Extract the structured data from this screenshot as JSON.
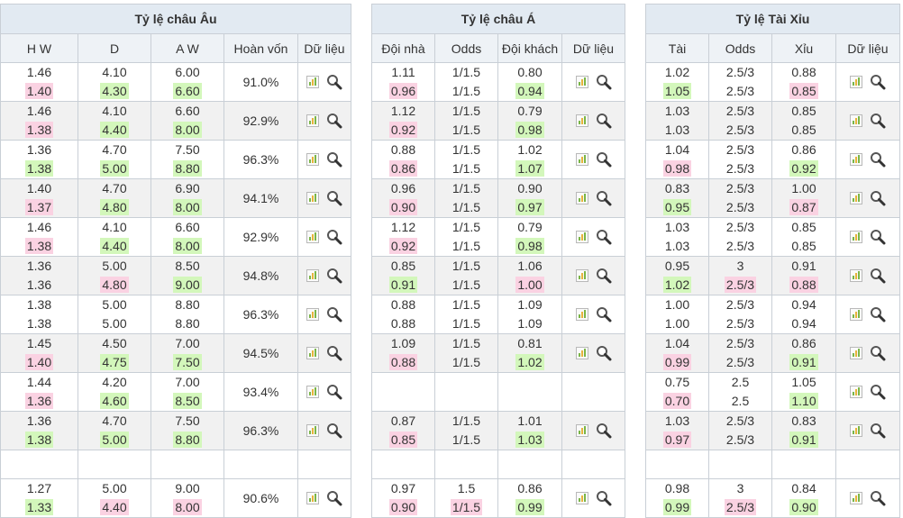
{
  "eu": {
    "title": "Tỷ lệ châu Âu",
    "headers": [
      "H W",
      "D",
      "A W",
      "Hoàn vốn",
      "Dữ liệu"
    ],
    "rows": [
      {
        "hw": [
          "1.46",
          "1.40"
        ],
        "d": [
          "4.10",
          "4.30"
        ],
        "aw": [
          "6.00",
          "6.60"
        ],
        "ret": "91.0%",
        "hl": [
          "down",
          "up",
          "up"
        ]
      },
      {
        "hw": [
          "1.46",
          "1.38"
        ],
        "d": [
          "4.10",
          "4.40"
        ],
        "aw": [
          "6.60",
          "8.00"
        ],
        "ret": "92.9%",
        "hl": [
          "down",
          "up",
          "up"
        ]
      },
      {
        "hw": [
          "1.36",
          "1.38"
        ],
        "d": [
          "4.70",
          "5.00"
        ],
        "aw": [
          "7.50",
          "8.80"
        ],
        "ret": "96.3%",
        "hl": [
          "up",
          "up",
          "up"
        ]
      },
      {
        "hw": [
          "1.40",
          "1.37"
        ],
        "d": [
          "4.70",
          "4.80"
        ],
        "aw": [
          "6.90",
          "8.00"
        ],
        "ret": "94.1%",
        "hl": [
          "down",
          "up",
          "up"
        ]
      },
      {
        "hw": [
          "1.46",
          "1.38"
        ],
        "d": [
          "4.10",
          "4.40"
        ],
        "aw": [
          "6.60",
          "8.00"
        ],
        "ret": "92.9%",
        "hl": [
          "down",
          "up",
          "up"
        ]
      },
      {
        "hw": [
          "1.36",
          "1.36"
        ],
        "d": [
          "5.00",
          "4.80"
        ],
        "aw": [
          "8.50",
          "9.00"
        ],
        "ret": "94.8%",
        "hl": [
          "",
          "down",
          "up"
        ]
      },
      {
        "hw": [
          "1.38",
          "1.38"
        ],
        "d": [
          "5.00",
          "5.00"
        ],
        "aw": [
          "8.80",
          "8.80"
        ],
        "ret": "96.3%",
        "hl": [
          "",
          "",
          ""
        ]
      },
      {
        "hw": [
          "1.45",
          "1.40"
        ],
        "d": [
          "4.50",
          "4.75"
        ],
        "aw": [
          "7.00",
          "7.50"
        ],
        "ret": "94.5%",
        "hl": [
          "down",
          "up",
          "up"
        ]
      },
      {
        "hw": [
          "1.44",
          "1.36"
        ],
        "d": [
          "4.20",
          "4.60"
        ],
        "aw": [
          "7.00",
          "8.50"
        ],
        "ret": "93.4%",
        "hl": [
          "down",
          "up",
          "up"
        ]
      },
      {
        "hw": [
          "1.36",
          "1.38"
        ],
        "d": [
          "4.70",
          "5.00"
        ],
        "aw": [
          "7.50",
          "8.80"
        ],
        "ret": "96.3%",
        "hl": [
          "up",
          "up",
          "up"
        ]
      },
      {
        "hw": [
          "1.27",
          "1.33"
        ],
        "d": [
          "5.00",
          "4.40"
        ],
        "aw": [
          "9.00",
          "8.00"
        ],
        "ret": "90.6%",
        "hl": [
          "up",
          "down",
          "down"
        ]
      }
    ]
  },
  "asia": {
    "title": "Tỷ lệ châu Á",
    "headers": [
      "Đội nhà",
      "Odds",
      "Đội khách",
      "Dữ liệu"
    ],
    "rows": [
      {
        "h": [
          "1.11",
          "0.96"
        ],
        "o": [
          "1/1.5",
          "1/1.5"
        ],
        "a": [
          "0.80",
          "0.94"
        ],
        "hl": [
          "down",
          "",
          "up"
        ]
      },
      {
        "h": [
          "1.12",
          "0.92"
        ],
        "o": [
          "1/1.5",
          "1/1.5"
        ],
        "a": [
          "0.79",
          "0.98"
        ],
        "hl": [
          "down",
          "",
          "up"
        ]
      },
      {
        "h": [
          "0.88",
          "0.86"
        ],
        "o": [
          "1/1.5",
          "1/1.5"
        ],
        "a": [
          "1.02",
          "1.07"
        ],
        "hl": [
          "down",
          "",
          "up"
        ]
      },
      {
        "h": [
          "0.96",
          "0.90"
        ],
        "o": [
          "1/1.5",
          "1/1.5"
        ],
        "a": [
          "0.90",
          "0.97"
        ],
        "hl": [
          "down",
          "",
          "up"
        ]
      },
      {
        "h": [
          "1.12",
          "0.92"
        ],
        "o": [
          "1/1.5",
          "1/1.5"
        ],
        "a": [
          "0.79",
          "0.98"
        ],
        "hl": [
          "down",
          "",
          "up"
        ]
      },
      {
        "h": [
          "0.85",
          "0.91"
        ],
        "o": [
          "1/1.5",
          "1/1.5"
        ],
        "a": [
          "1.06",
          "1.00"
        ],
        "hl": [
          "up",
          "",
          "down"
        ]
      },
      {
        "h": [
          "0.88",
          "0.88"
        ],
        "o": [
          "1/1.5",
          "1/1.5"
        ],
        "a": [
          "1.09",
          "1.09"
        ],
        "hl": [
          "",
          "",
          ""
        ]
      },
      {
        "h": [
          "1.09",
          "0.88"
        ],
        "o": [
          "1/1.5",
          "1/1.5"
        ],
        "a": [
          "0.81",
          "1.02"
        ],
        "hl": [
          "down",
          "",
          "up"
        ]
      },
      null,
      {
        "h": [
          "0.87",
          "0.85"
        ],
        "o": [
          "1/1.5",
          "1/1.5"
        ],
        "a": [
          "1.01",
          "1.03"
        ],
        "hl": [
          "down",
          "",
          "up"
        ]
      },
      {
        "h": [
          "0.97",
          "0.90"
        ],
        "o": [
          "1.5",
          "1/1.5"
        ],
        "a": [
          "0.86",
          "0.99"
        ],
        "hl": [
          "down",
          "down",
          "up"
        ]
      }
    ]
  },
  "ou": {
    "title": "Tỷ lệ Tài Xỉu",
    "headers": [
      "Tài",
      "Odds",
      "Xỉu",
      "Dữ liệu"
    ],
    "rows": [
      {
        "o": [
          "1.02",
          "1.05"
        ],
        "l": [
          "2.5/3",
          "2.5/3"
        ],
        "u": [
          "0.88",
          "0.85"
        ],
        "hl": [
          "up",
          "",
          "down"
        ]
      },
      {
        "o": [
          "1.03",
          "1.03"
        ],
        "l": [
          "2.5/3",
          "2.5/3"
        ],
        "u": [
          "0.85",
          "0.85"
        ],
        "hl": [
          "",
          "",
          ""
        ]
      },
      {
        "o": [
          "1.04",
          "0.98"
        ],
        "l": [
          "2.5/3",
          "2.5/3"
        ],
        "u": [
          "0.86",
          "0.92"
        ],
        "hl": [
          "down",
          "",
          "up"
        ]
      },
      {
        "o": [
          "0.83",
          "0.95"
        ],
        "l": [
          "2.5/3",
          "2.5/3"
        ],
        "u": [
          "1.00",
          "0.87"
        ],
        "hl": [
          "up",
          "",
          "down"
        ]
      },
      {
        "o": [
          "1.03",
          "1.03"
        ],
        "l": [
          "2.5/3",
          "2.5/3"
        ],
        "u": [
          "0.85",
          "0.85"
        ],
        "hl": [
          "",
          "",
          ""
        ]
      },
      {
        "o": [
          "0.95",
          "1.02"
        ],
        "l": [
          "3",
          "2.5/3"
        ],
        "u": [
          "0.91",
          "0.88"
        ],
        "hl": [
          "up",
          "down",
          "down"
        ]
      },
      {
        "o": [
          "1.00",
          "1.00"
        ],
        "l": [
          "2.5/3",
          "2.5/3"
        ],
        "u": [
          "0.94",
          "0.94"
        ],
        "hl": [
          "",
          "",
          ""
        ]
      },
      {
        "o": [
          "1.04",
          "0.99"
        ],
        "l": [
          "2.5/3",
          "2.5/3"
        ],
        "u": [
          "0.86",
          "0.91"
        ],
        "hl": [
          "down",
          "",
          "up"
        ]
      },
      {
        "o": [
          "0.75",
          "0.70"
        ],
        "l": [
          "2.5",
          "2.5"
        ],
        "u": [
          "1.05",
          "1.10"
        ],
        "hl": [
          "down",
          "",
          "up"
        ]
      },
      {
        "o": [
          "1.03",
          "0.97"
        ],
        "l": [
          "2.5/3",
          "2.5/3"
        ],
        "u": [
          "0.83",
          "0.91"
        ],
        "hl": [
          "down",
          "",
          "up"
        ]
      },
      {
        "o": [
          "0.98",
          "0.99"
        ],
        "l": [
          "3",
          "2.5/3"
        ],
        "u": [
          "0.84",
          "0.90"
        ],
        "hl": [
          "up",
          "down",
          "up"
        ]
      }
    ]
  },
  "colors": {
    "up": "#d3f7bb",
    "down": "#fad2e2",
    "header": "#e2eaf2",
    "alt_row": "#f1f1f1"
  },
  "icons": [
    "chart-icon",
    "search-icon"
  ]
}
